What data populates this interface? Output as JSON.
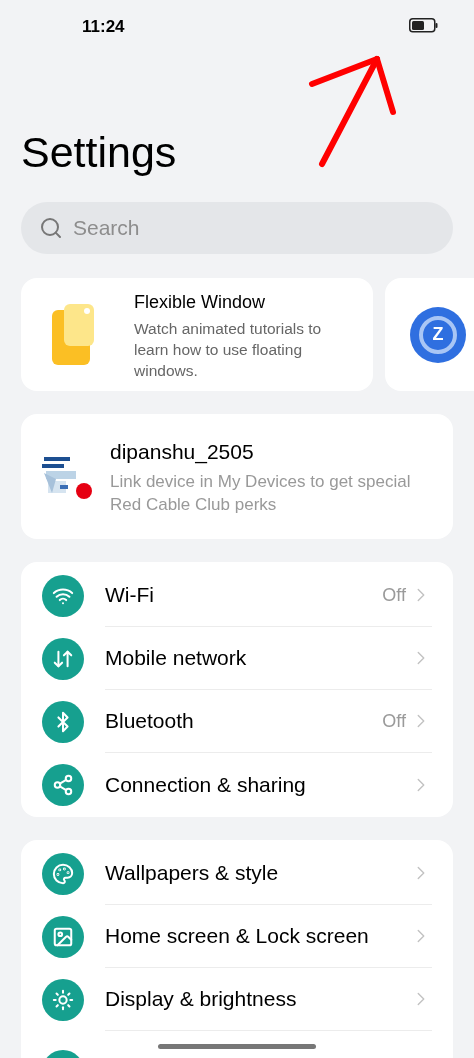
{
  "status_bar": {
    "time": "11:24"
  },
  "title": "Settings",
  "search": {
    "placeholder": "Search"
  },
  "carousel": [
    {
      "title": "Flexible Window",
      "description": "Watch animated tutorials to learn how to use floating windows."
    },
    {
      "badge": "Z"
    }
  ],
  "account": {
    "name": "dipanshu_2505",
    "description": "Link device in My Devices to get special Red Cable Club perks"
  },
  "groups": [
    {
      "items": [
        {
          "label": "Wi-Fi",
          "value": "Off"
        },
        {
          "label": "Mobile network"
        },
        {
          "label": "Bluetooth",
          "value": "Off"
        },
        {
          "label": "Connection & sharing"
        }
      ]
    },
    {
      "items": [
        {
          "label": "Wallpapers & style"
        },
        {
          "label": "Home screen & Lock screen"
        },
        {
          "label": "Display & brightness"
        }
      ]
    }
  ]
}
